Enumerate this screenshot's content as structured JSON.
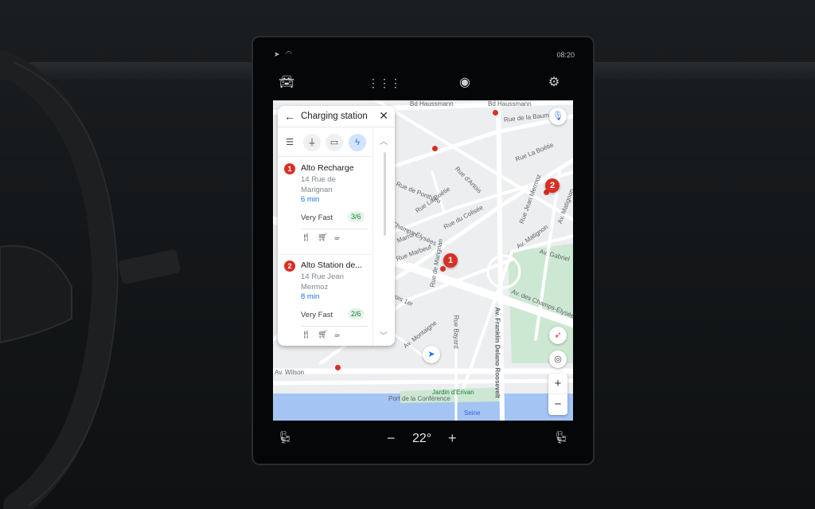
{
  "status_bar": {
    "time": "08:20",
    "icons": [
      "navigation-arrow-icon",
      "wifi-icon"
    ]
  },
  "top_bar": {
    "icons": [
      "car-icon",
      "apps-grid-icon",
      "account-icon",
      "settings-gear-icon"
    ]
  },
  "panel": {
    "title": "Charging station",
    "back_icon": "arrow-left-icon",
    "close_icon": "close-icon",
    "filters": [
      {
        "icon": "tune-icon",
        "active": false
      },
      {
        "icon": "plug-icon",
        "active": false
      },
      {
        "icon": "credit-card-icon",
        "active": false
      },
      {
        "icon": "fast-charge-icon",
        "active": true
      }
    ],
    "results": [
      {
        "number": "1",
        "name": "Alto Recharge",
        "address": "14 Rue de Marignan",
        "eta": "6 min",
        "speed": "Very Fast",
        "availability": "3/6",
        "amenities": [
          "restaurant-icon",
          "cart-icon",
          "cafe-icon"
        ]
      },
      {
        "number": "2",
        "name": "Alto Station de...",
        "address": "14 Rue Jean Mermoz",
        "eta": "8 min",
        "speed": "Very Fast",
        "availability": "2/6",
        "amenities": [
          "restaurant-icon",
          "cart-icon",
          "cafe-icon"
        ]
      }
    ]
  },
  "map": {
    "streets": [
      "Bd Haussmann",
      "Bd Haussmann",
      "Rue de la Baume",
      "Rue La Boétie",
      "Rue d'Artois",
      "Rue de Ponthieu",
      "Rue La Boétie",
      "Rue du Colisée",
      "Rue Jean Mermoz",
      "Av. Matignon",
      "Av. Matignon",
      "Av. Gabriel",
      "Champs-Élysées",
      "Rue Marbeuf",
      "Rue de Marignan",
      "Av. des Champs-Élysées",
      "Av. Franklin Delano Roosevelt",
      "Rue Bayard",
      "Av. Montaigne",
      "Marron",
      "çois 1er",
      "Av. Wilson",
      "Jardin d'Erivan",
      "Port de la Conférence",
      "Seine"
    ],
    "markers": [
      "1",
      "2"
    ],
    "controls": {
      "mic_icon": "microphone-icon",
      "compass_icon": "compass-icon",
      "recenter_icon": "my-location-icon",
      "zoom_in": "+",
      "zoom_out": "−",
      "nav_icon": "navigation-arrow-icon"
    }
  },
  "climate": {
    "temperature": "22°",
    "decrease": "−",
    "increase": "+",
    "left_seat_icon": "seat-heat-icon",
    "right_seat_icon": "seat-heat-icon"
  },
  "colors": {
    "accent": "#1a73e8",
    "marker": "#d93025",
    "availability": "#188038",
    "water": "#a4c4f4",
    "park": "#cde8d2"
  }
}
